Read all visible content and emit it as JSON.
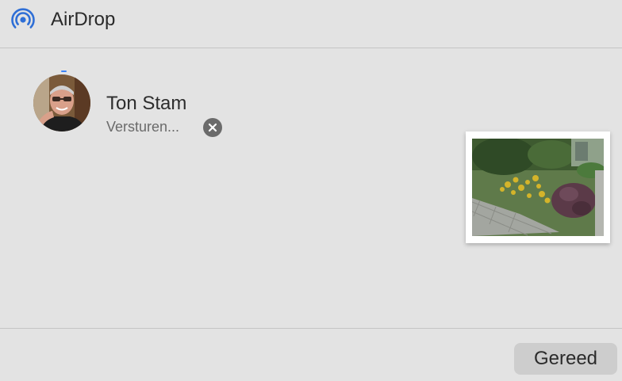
{
  "header": {
    "title": "AirDrop",
    "icon": "airdrop-icon",
    "accent_color": "#2f6fd6"
  },
  "recipient": {
    "name": "Ton Stam",
    "status": "Versturen...",
    "avatar": "avatar-photo",
    "cancel_icon": "close-icon"
  },
  "attachment": {
    "type": "photo",
    "subject": "garden-flowers"
  },
  "footer": {
    "done_label": "Gereed"
  }
}
